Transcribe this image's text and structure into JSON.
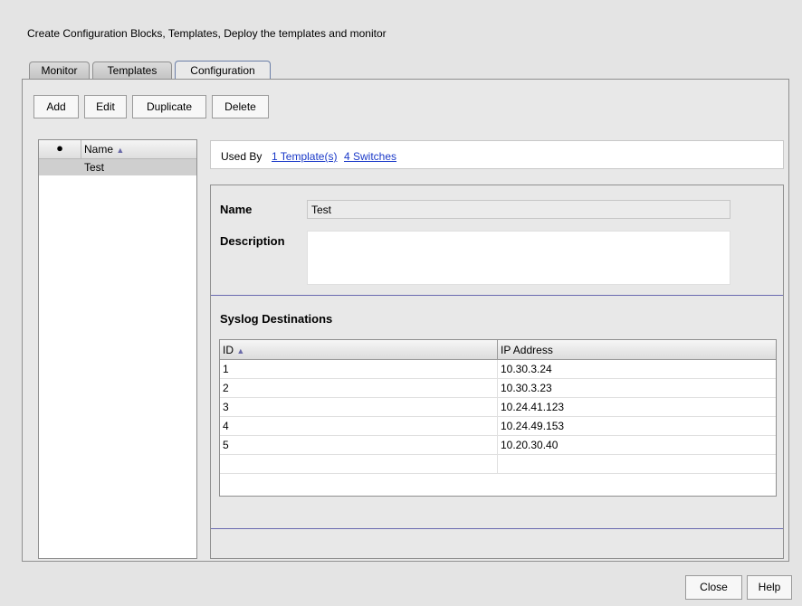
{
  "header": {
    "description": "Create Configuration Blocks, Templates, Deploy the templates and monitor"
  },
  "tabs": [
    {
      "label": "Monitor"
    },
    {
      "label": "Templates"
    },
    {
      "label": "Configuration",
      "active": true
    }
  ],
  "toolbar": {
    "add": "Add",
    "edit": "Edit",
    "duplicate": "Duplicate",
    "delete": "Delete"
  },
  "list": {
    "dot_header": "●",
    "name_header": "Name",
    "rows": [
      {
        "name": "Test"
      }
    ]
  },
  "used_by": {
    "label": "Used By",
    "templates_link": "1 Template(s)",
    "switches_link": "4 Switches"
  },
  "detail": {
    "name_label": "Name",
    "name_value": "Test",
    "description_label": "Description",
    "description_value": "",
    "syslog_title": "Syslog Destinations",
    "table": {
      "col_id": "ID",
      "col_ip": "IP Address",
      "rows": [
        {
          "id": "1",
          "ip": "10.30.3.24"
        },
        {
          "id": "2",
          "ip": "10.30.3.23"
        },
        {
          "id": "3",
          "ip": "10.24.41.123"
        },
        {
          "id": "4",
          "ip": "10.24.49.153"
        },
        {
          "id": "5",
          "ip": "10.20.30.40"
        }
      ]
    }
  },
  "footer": {
    "close": "Close",
    "help": "Help"
  },
  "colors": {
    "link": "#1a39c8",
    "accent_line": "#6a6ab0"
  },
  "icons": {
    "sort": "sort-ascending-icon",
    "bullet": "bullet-icon"
  }
}
